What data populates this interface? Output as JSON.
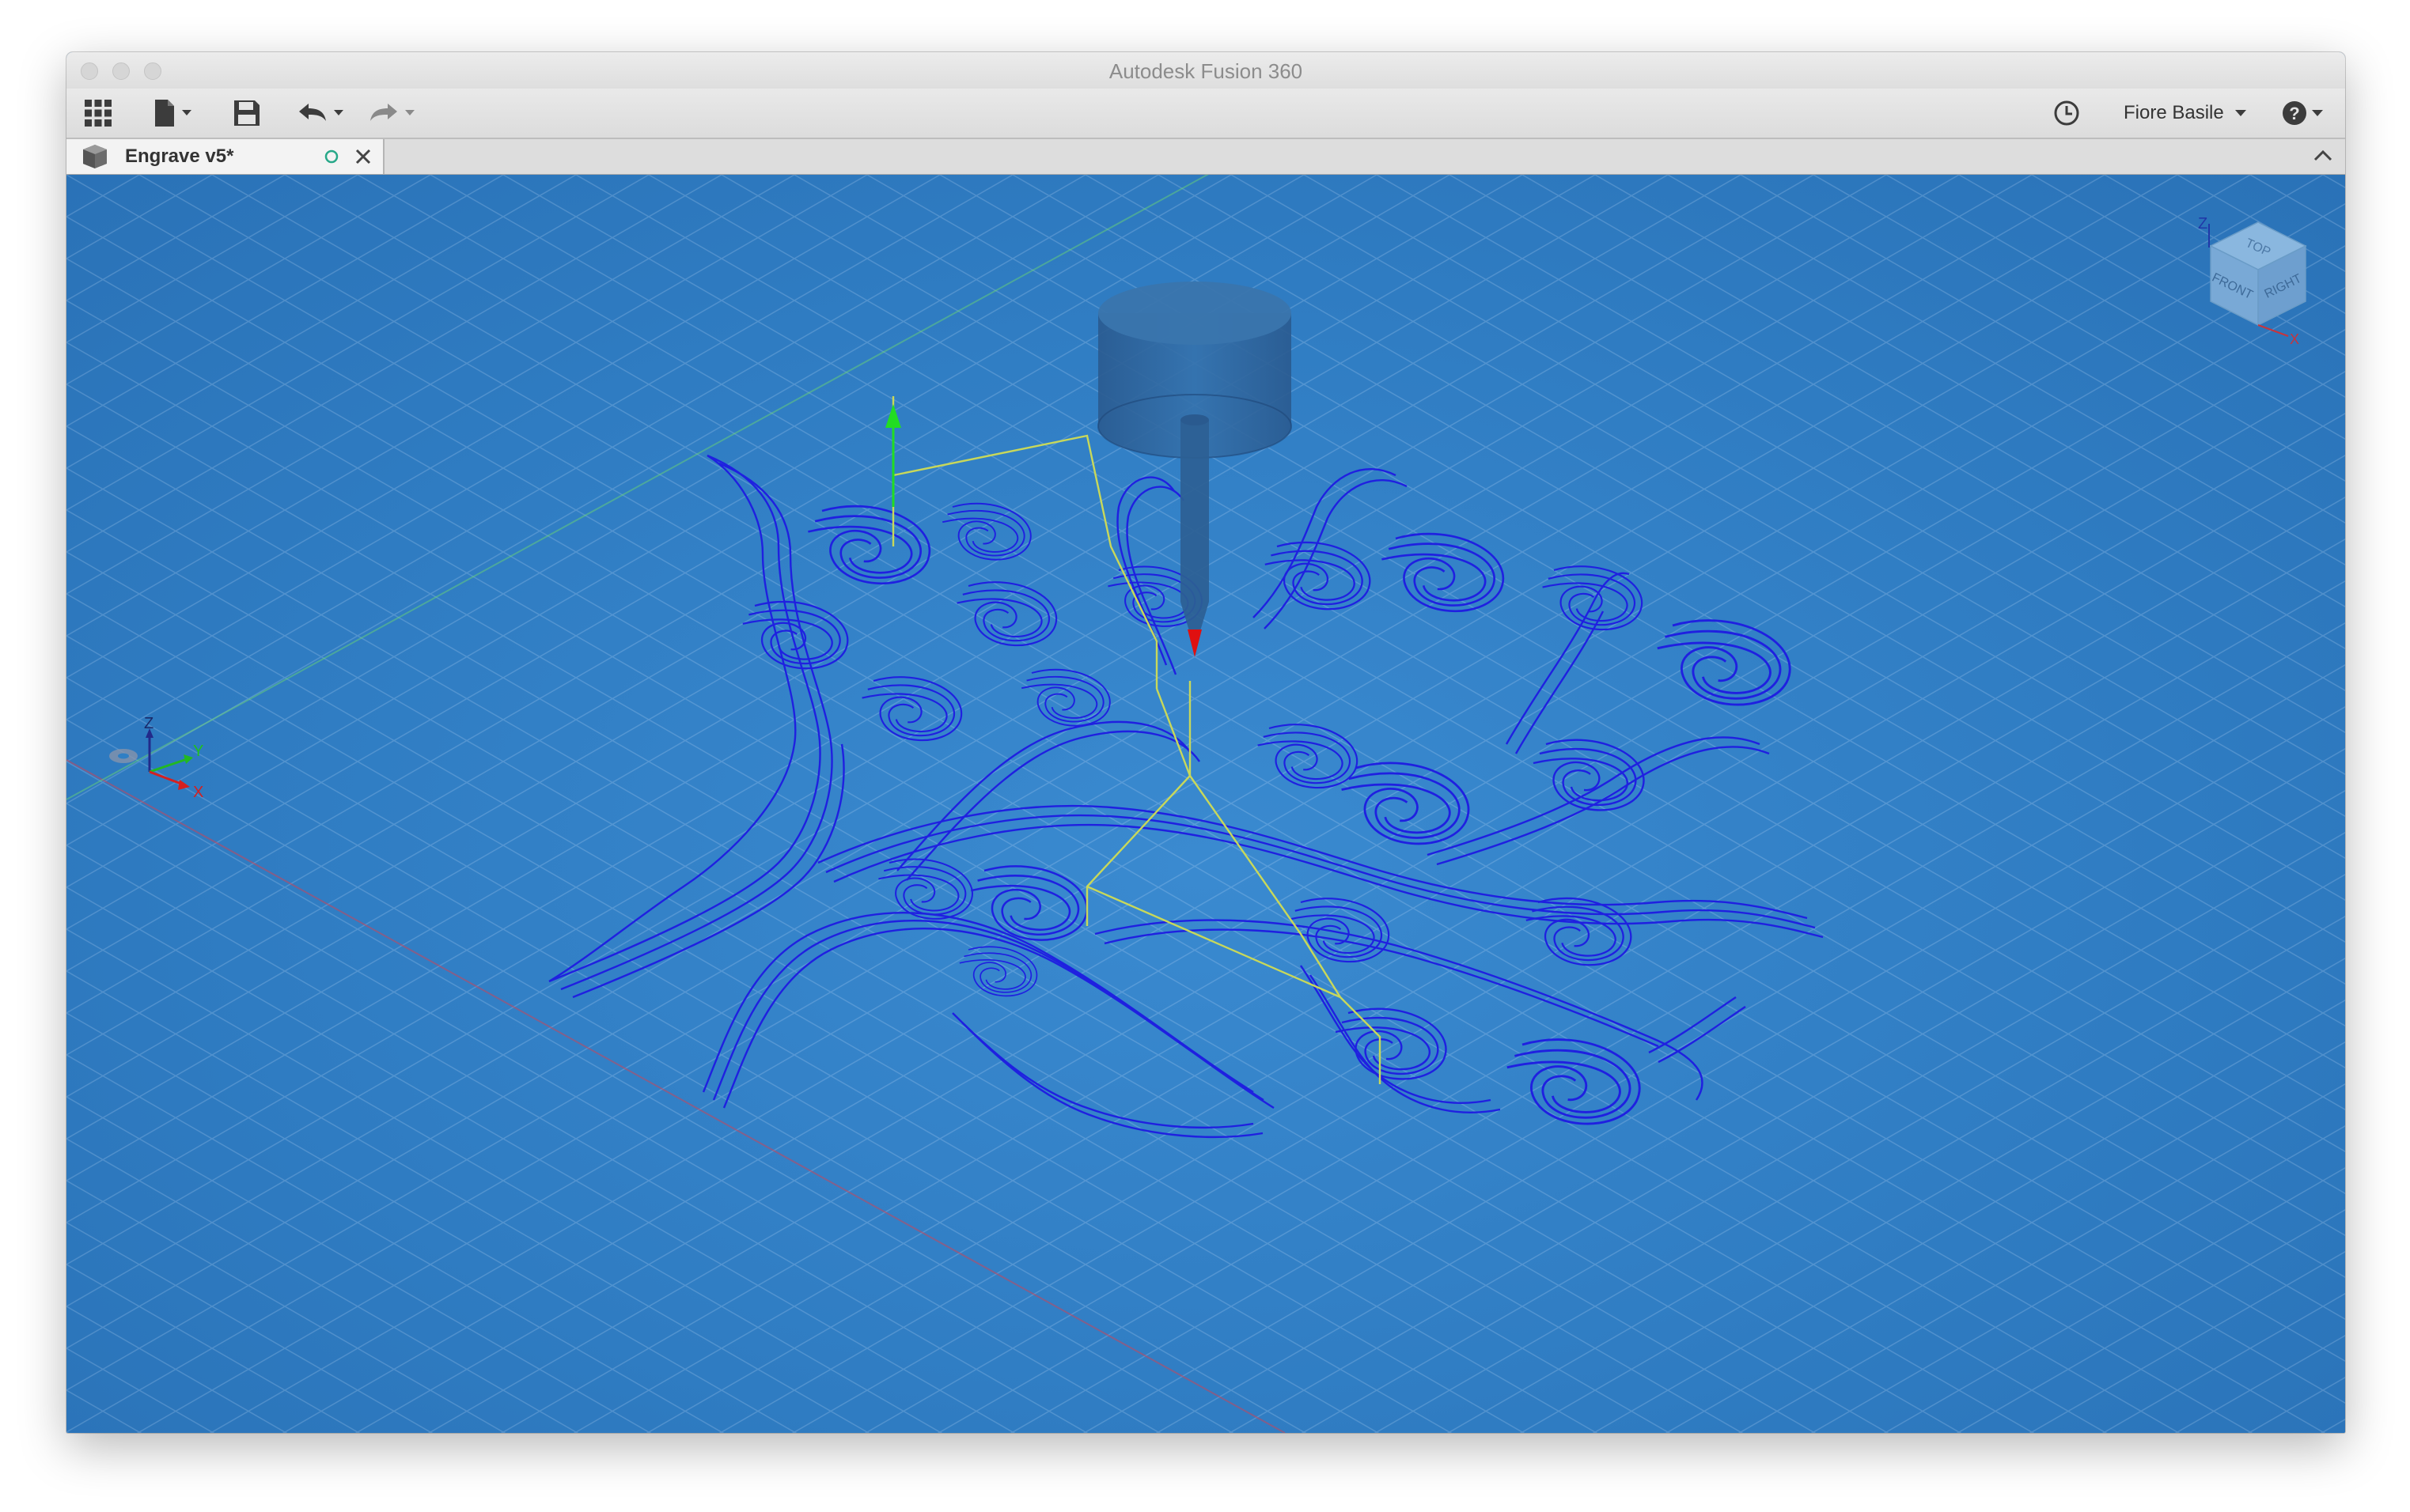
{
  "window": {
    "title": "Autodesk Fusion 360"
  },
  "toolbar": {
    "user_name": "Fiore Basile"
  },
  "document_tab": {
    "label": "Engrave v5*"
  },
  "axis_triad": {
    "z_label": "Z",
    "y_label": "Y",
    "x_label": "X"
  },
  "view_cube": {
    "top_label": "TOP",
    "front_label": "FRONT",
    "right_label": "RIGHT",
    "z_label": "Z",
    "x_label": "X"
  },
  "colors": {
    "viewport_bg": "#2f7fc4",
    "toolpath": "#1f20e0",
    "rapid_move": "#c8d85a",
    "tool_body": "#2c5f94",
    "tool_tip": "#e01010",
    "origin_arrow": "#22dd22"
  }
}
